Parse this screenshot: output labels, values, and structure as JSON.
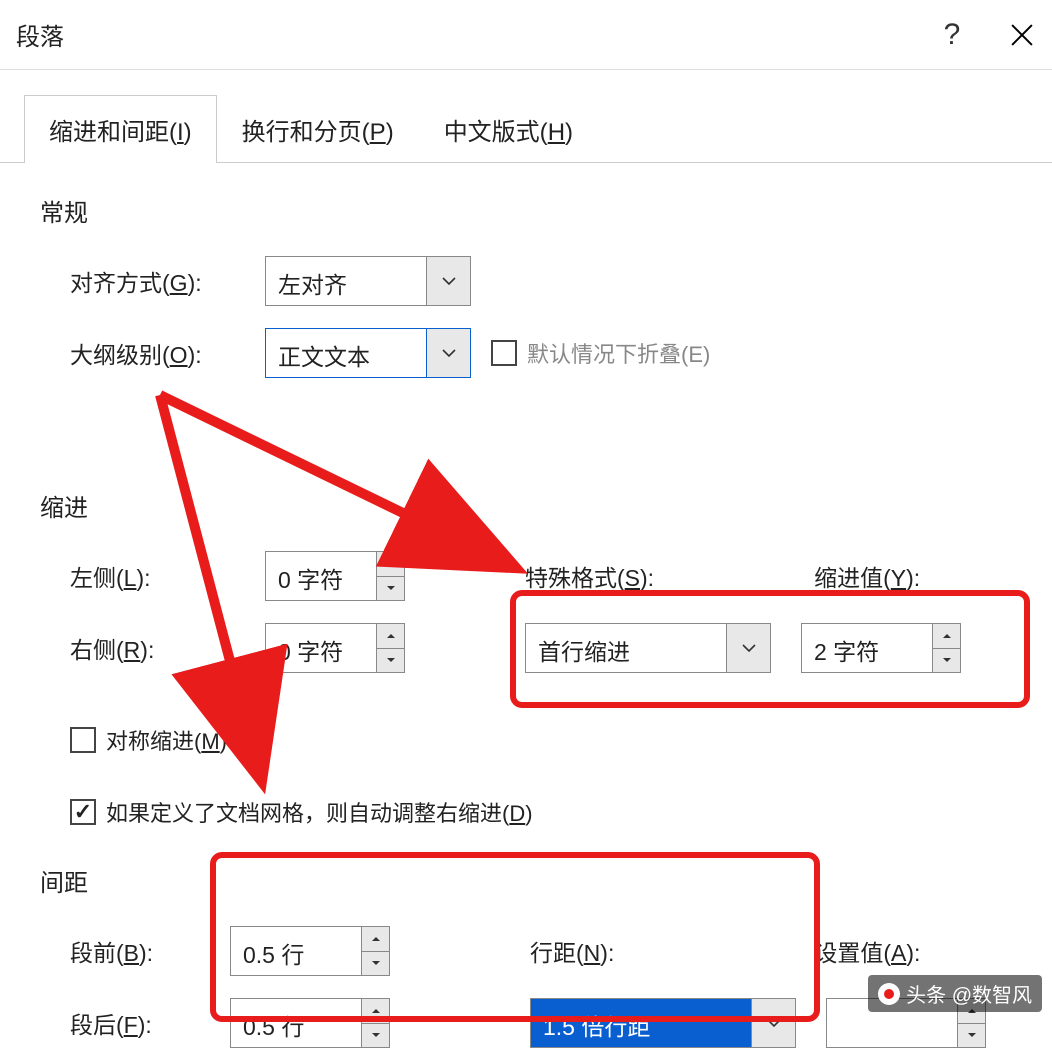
{
  "titlebar": {
    "title": "段落",
    "help": "?"
  },
  "tabs": {
    "t1": "缩进和间距(",
    "t1k": "I",
    "t1e": ")",
    "t2": "换行和分页(",
    "t2k": "P",
    "t2e": ")",
    "t3": "中文版式(",
    "t3k": "H",
    "t3e": ")"
  },
  "general": {
    "section": "常规",
    "align_label_a": "对齐方式(",
    "align_k": "G",
    "align_e": "):",
    "align_value": "左对齐",
    "outline_label_a": "大纲级别(",
    "outline_k": "O",
    "outline_e": "):",
    "outline_value": "正文文本",
    "collapse_label_a": "默认情况下折叠(",
    "collapse_k": "E",
    "collapse_e": ")"
  },
  "indent": {
    "section": "缩进",
    "left_a": "左侧(",
    "left_k": "L",
    "left_e": "):",
    "left_val": "0 字符",
    "right_a": "右侧(",
    "right_k": "R",
    "right_e": "):",
    "right_val": "0 字符",
    "special_a": "特殊格式(",
    "special_k": "S",
    "special_e": "):",
    "special_val": "首行缩进",
    "by_a": "缩进值(",
    "by_k": "Y",
    "by_e": "):",
    "by_val": "2 字符",
    "mirror_a": "对称缩进(",
    "mirror_k": "M",
    "mirror_e": ")",
    "grid_a": "如果定义了文档网格，则自动调整右缩进(",
    "grid_k": "D",
    "grid_e": ")"
  },
  "spacing": {
    "section": "间距",
    "before_a": "段前(",
    "before_k": "B",
    "before_e": "):",
    "before_val": "0.5 行",
    "after_a": "段后(",
    "after_k": "F",
    "after_e": "):",
    "after_val": "0.5 行",
    "line_a": "行距(",
    "line_k": "N",
    "line_e": "):",
    "line_val": "1.5 倍行距",
    "at_a": "设置值(",
    "at_k": "A",
    "at_e": "):"
  },
  "watermark": "头条 @数智风"
}
